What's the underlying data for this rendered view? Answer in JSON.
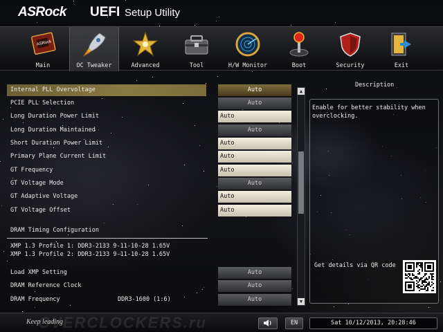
{
  "header": {
    "brand": "ASRock",
    "product": "UEFI",
    "subtitle": "Setup Utility"
  },
  "tabs": [
    {
      "label": "Main",
      "icon": "main-chip-icon"
    },
    {
      "label": "OC Tweaker",
      "icon": "rocket-icon"
    },
    {
      "label": "Advanced",
      "icon": "star-burst-icon"
    },
    {
      "label": "Tool",
      "icon": "toolbox-icon"
    },
    {
      "label": "H/W Monitor",
      "icon": "radar-icon"
    },
    {
      "label": "Boot",
      "icon": "joystick-icon"
    },
    {
      "label": "Security",
      "icon": "shield-icon"
    },
    {
      "label": "Exit",
      "icon": "exit-door-icon"
    }
  ],
  "active_tab": "OC Tweaker",
  "settings": [
    {
      "label": "Internal PLL Overvoltage",
      "value": "Auto"
    },
    {
      "label": "PCIE PLL Selection",
      "value": "Auto"
    },
    {
      "label": "Long Duration Power Limit",
      "value": "Auto"
    },
    {
      "label": "Long Duration Maintained",
      "value": "Auto"
    },
    {
      "label": "Short Duration Power Limit",
      "value": "Auto"
    },
    {
      "label": "Primary Plane Current Limit",
      "value": "Auto"
    },
    {
      "label": "GT Frequency",
      "value": "Auto"
    },
    {
      "label": "GT Voltage Mode",
      "value": "Auto"
    },
    {
      "label": "GT Adaptive Voltage",
      "value": "Auto"
    },
    {
      "label": "GT Voltage Offset",
      "value": "Auto"
    }
  ],
  "dram": {
    "section_title": "DRAM Timing Configuration",
    "xmp_profile_1": "XMP 1.3 Profile 1: DDR3-2133 9-11-10-28 1.65V",
    "xmp_profile_2": "XMP 1.3 Profile 2: DDR3-2133 9-11-10-28 1.65V",
    "settings": [
      {
        "label": "Load XMP Setting",
        "value": "Auto"
      },
      {
        "label": "DRAM Reference Clock",
        "value": "Auto"
      },
      {
        "label": "DRAM Frequency",
        "extra": "DDR3-1600 (1:6)",
        "value": "Auto"
      }
    ]
  },
  "description": {
    "title": "Description",
    "text": "Enable for better stability when overclocking.",
    "qr_label": "Get details via QR code"
  },
  "footer": {
    "slogan": "Keep leading",
    "watermark": "OVERCLOCKERS.ru",
    "language": "EN",
    "datetime": "Sat 10/12/2013, 20:28:46"
  },
  "colors": {
    "selected_row": "#8a7a42",
    "grey_value": "#4a4b4f",
    "light_value": "#e9e4d2"
  }
}
